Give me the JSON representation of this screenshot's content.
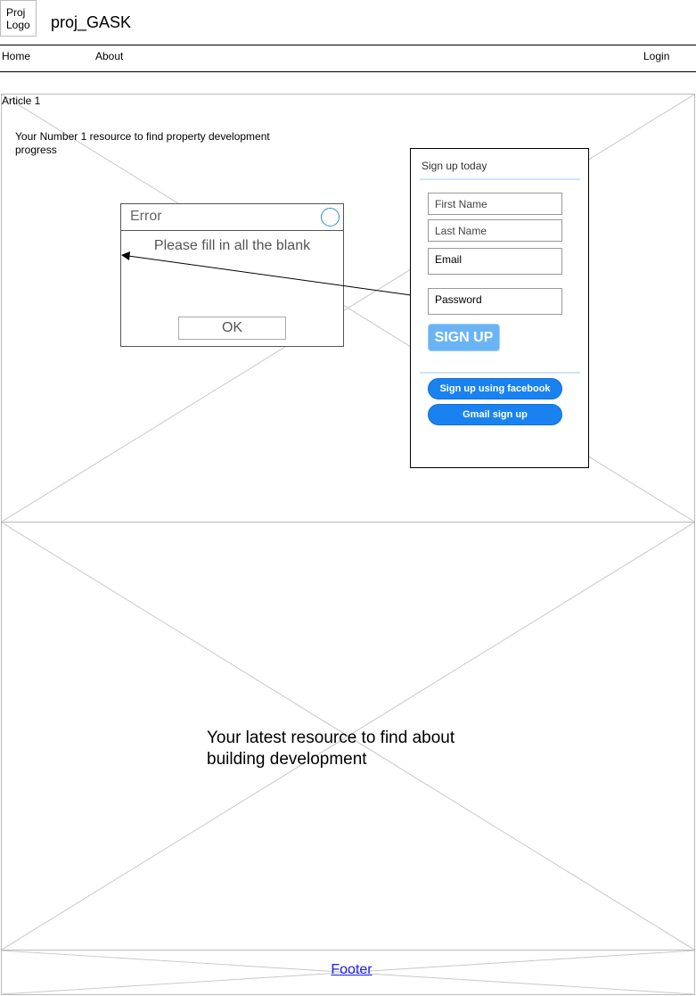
{
  "header": {
    "logo_text": "Proj Logo",
    "site_title": "proj_GASK"
  },
  "nav": {
    "home": "Home",
    "about": "About",
    "login": "Login"
  },
  "article": {
    "label": "Article 1",
    "tagline": "Your Number 1 resource to find property development progress"
  },
  "signup": {
    "title": "Sign up today",
    "first_name_placeholder": "First Name",
    "last_name_placeholder": "Last Name",
    "email_label": "Email",
    "password_label": "Password",
    "signup_button": "SIGN UP",
    "facebook_button": "Sign up using facebook",
    "gmail_button": "Gmail sign up"
  },
  "error_dialog": {
    "title": "Error",
    "message": "Please fill in all the blank",
    "ok_button": "OK"
  },
  "hero": {
    "text": "Your latest resource to find about building development"
  },
  "footer": {
    "link_text": "Footer"
  },
  "colors": {
    "accent_button": "#6ab4f5",
    "social_button": "#1a82f0",
    "close_ring": "#2a8fd6",
    "footer_link": "#1a1aee"
  }
}
